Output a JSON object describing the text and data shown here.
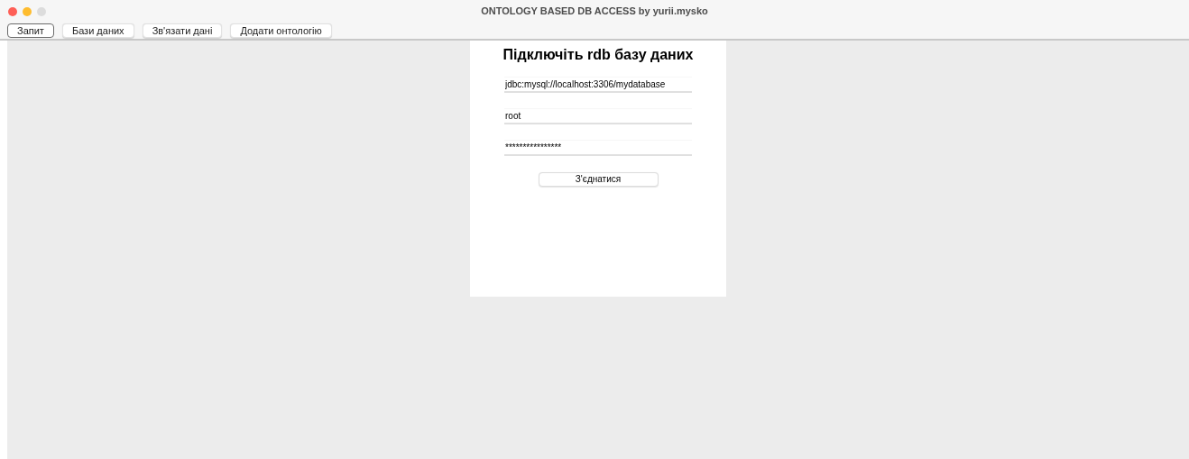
{
  "window": {
    "title": "ONTOLOGY BASED DB ACCESS by yurii.mysko"
  },
  "tabs": [
    {
      "label": "Запит",
      "selected": true
    },
    {
      "label": "Бази даних",
      "selected": false
    },
    {
      "label": "Зв'язати дані",
      "selected": false
    },
    {
      "label": "Додати онтологію",
      "selected": false
    }
  ],
  "form": {
    "heading": "Підключіть rdb базу даних",
    "fields": [
      {
        "value": "jdbc:mysql://localhost:3306/mydatabase"
      },
      {
        "value": "root"
      },
      {
        "value": "****************"
      }
    ],
    "button": "З'єднатися"
  }
}
